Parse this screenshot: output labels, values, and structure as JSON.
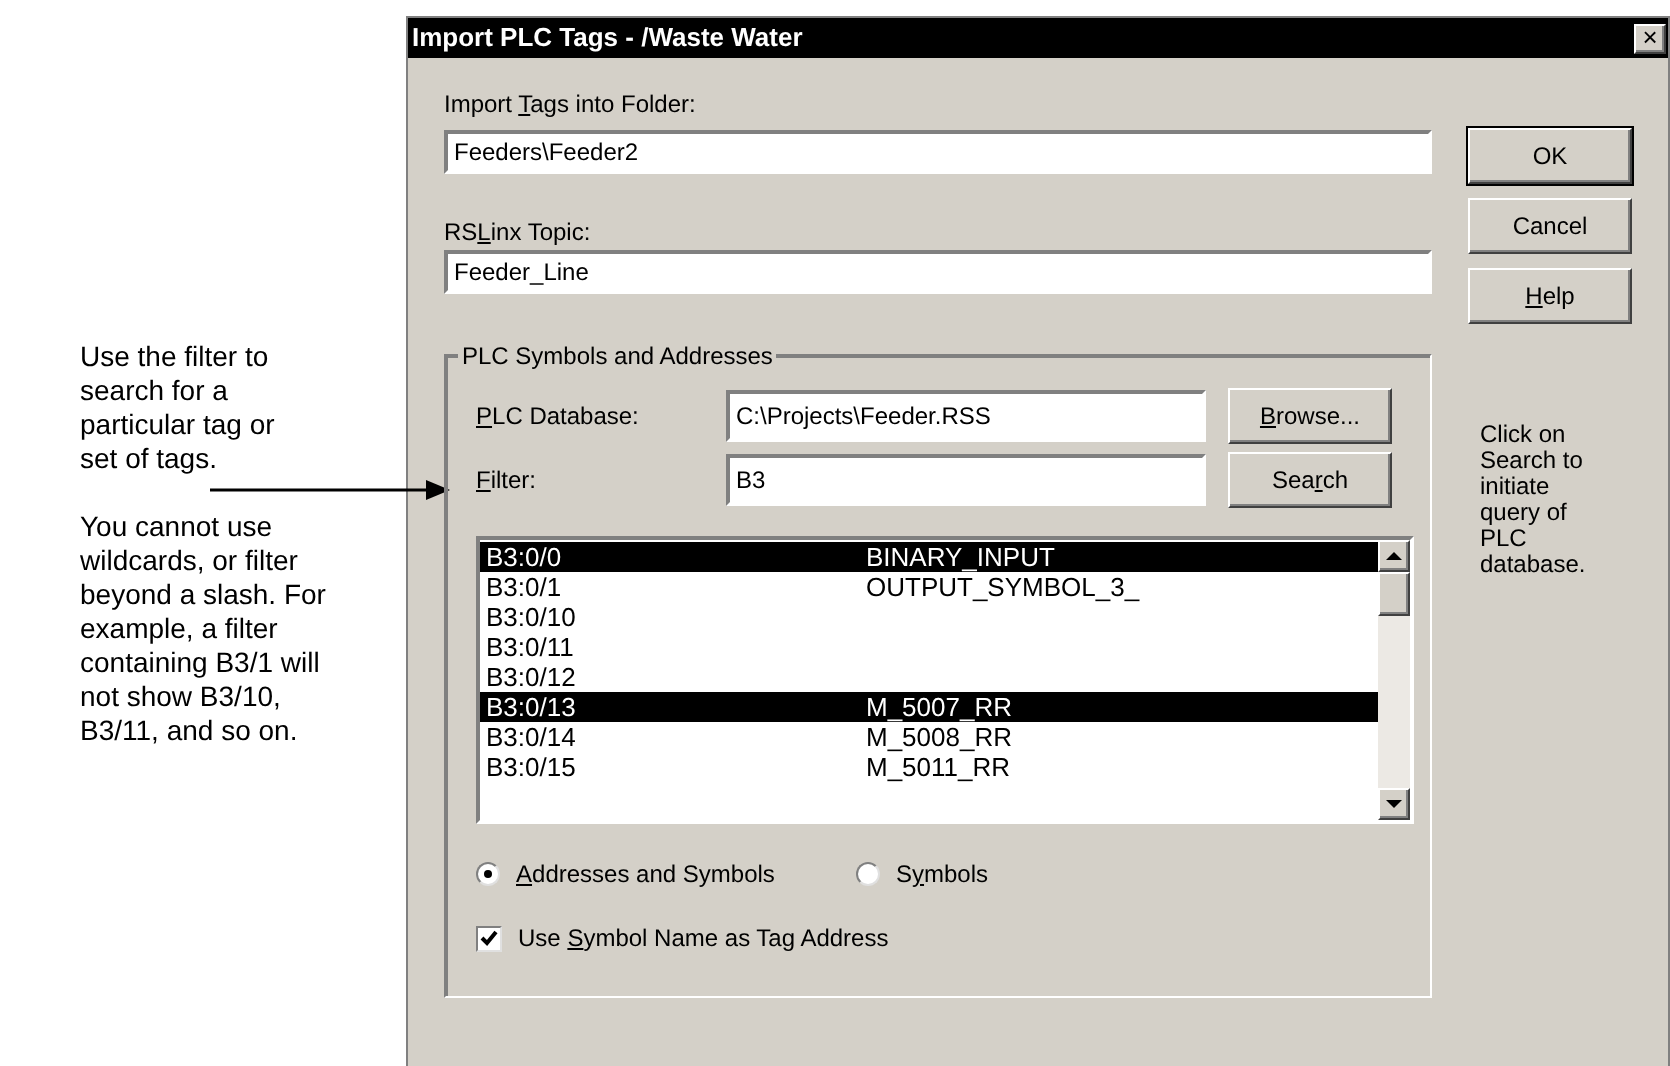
{
  "annotations": {
    "filter_note": "Use the filter to search for a particular tag or set of tags.",
    "limit_note": "You cannot use wildcards, or filter beyond a slash. For example, a filter containing B3/1 will not show B3/10, B3/11, and so on.",
    "search_note": "Click on Search to initiate query of PLC database."
  },
  "window": {
    "title": "Import PLC Tags - /Waste Water",
    "close": "×"
  },
  "folder": {
    "label": {
      "pre": "Import ",
      "key": "T",
      "post": "ags into Folder:"
    },
    "value": "Feeders\\Feeder2"
  },
  "topic": {
    "label": {
      "pre": "RS",
      "key": "L",
      "post": "inx Topic:"
    },
    "value": "Feeder_Line"
  },
  "buttons": [
    {
      "label": {
        "post": "OK"
      },
      "default": true
    },
    {
      "label": {
        "post": "Cancel"
      },
      "default": false
    },
    {
      "label": {
        "key": "H",
        "post": "elp"
      },
      "default": false
    }
  ],
  "group": {
    "title": "PLC Symbols and Addresses",
    "database": {
      "label": {
        "key": "P",
        "post": "LC Database:"
      },
      "value": "C:\\Projects\\Feeder.RSS",
      "button": {
        "key": "B",
        "post": "rowse..."
      }
    },
    "filter": {
      "label": {
        "key": "F",
        "post": "ilter:"
      },
      "value": "B3",
      "button": {
        "pre": "Sea",
        "key": "r",
        "post": "ch"
      }
    },
    "list": [
      {
        "address": "B3:0/0",
        "symbol": "BINARY_INPUT",
        "selected": true
      },
      {
        "address": "B3:0/1",
        "symbol": "OUTPUT_SYMBOL_3_",
        "selected": false
      },
      {
        "address": "B3:0/10",
        "selected": false
      },
      {
        "address": "B3:0/11",
        "selected": false
      },
      {
        "address": "B3:0/12",
        "selected": false
      },
      {
        "address": "B3:0/13",
        "symbol": "M_5007_RR",
        "selected": true
      },
      {
        "address": "B3:0/14",
        "symbol": "M_5008_RR",
        "selected": false
      },
      {
        "address": "B3:0/15",
        "symbol": "M_5011_RR",
        "selected": false
      }
    ],
    "radios": [
      {
        "label": {
          "key": "A",
          "post": "ddresses and Symbols"
        },
        "selected": true
      },
      {
        "label": {
          "pre": "S",
          "key": "y",
          "post": "mbols"
        },
        "selected": false
      }
    ],
    "checkbox": {
      "label": {
        "pre": "Use ",
        "key": "S",
        "post": "ymbol Name as Tag Address"
      },
      "checked": true
    }
  }
}
